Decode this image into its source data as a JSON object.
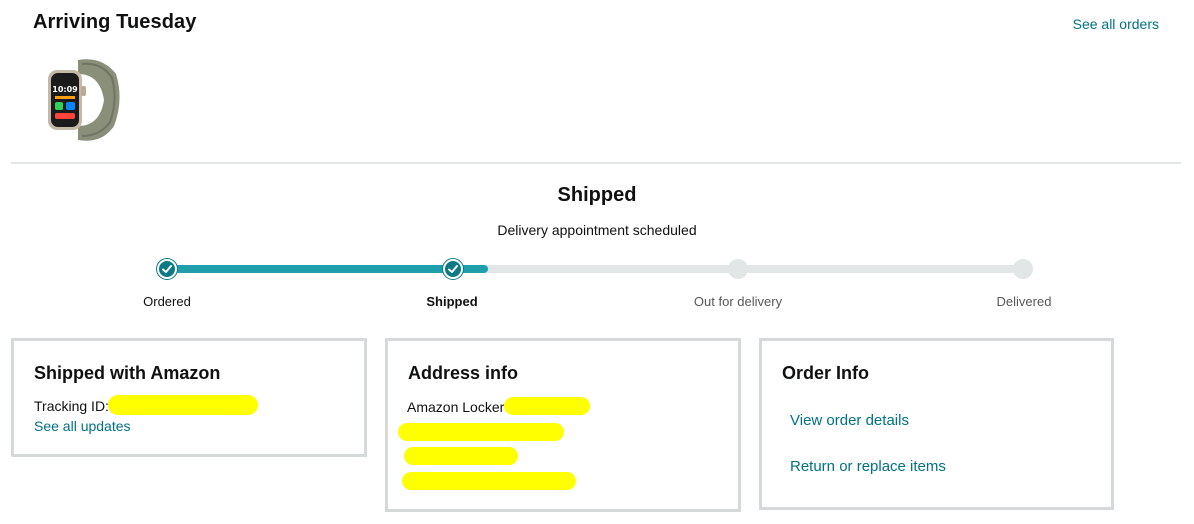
{
  "header": {
    "arriving": "Arriving Tuesday",
    "see_all_orders": "See all orders",
    "product_image": "apple-watch-ultra-image"
  },
  "status": {
    "title": "Shipped",
    "subtitle": "Delivery appointment scheduled",
    "progress": 0.375,
    "steps": [
      {
        "label": "Ordered",
        "state": "done"
      },
      {
        "label": "Shipped",
        "state": "current"
      },
      {
        "label": "Out for delivery",
        "state": "pending"
      },
      {
        "label": "Delivered",
        "state": "pending"
      }
    ]
  },
  "cards": {
    "shipping": {
      "title": "Shipped with Amazon",
      "tracking_label": "Tracking ID:",
      "see_updates": "See all updates"
    },
    "address": {
      "title": "Address info",
      "line1": "Amazon Locker"
    },
    "order": {
      "title": "Order Info",
      "view_details": "View order details",
      "return": "Return or replace items"
    }
  },
  "colors": {
    "accent": "#1e9fab",
    "link": "#007185",
    "redaction": "#ffff00",
    "border": "#d5d9d9"
  }
}
